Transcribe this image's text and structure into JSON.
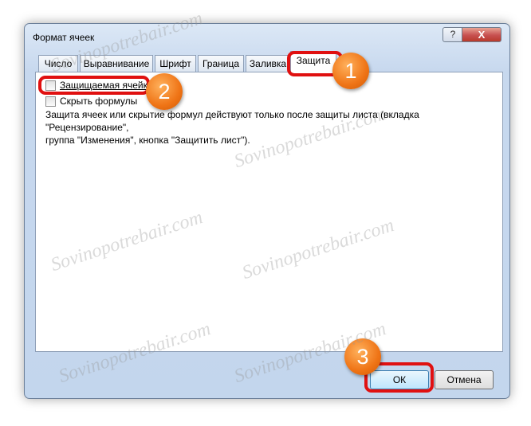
{
  "window": {
    "title": "Формат ячеек",
    "help_label": "?",
    "close_label": "X"
  },
  "tabs": [
    {
      "label": "Число"
    },
    {
      "label": "Выравнивание"
    },
    {
      "label": "Шрифт"
    },
    {
      "label": "Граница"
    },
    {
      "label": "Заливка"
    },
    {
      "label": "Защита",
      "active": true
    }
  ],
  "protection": {
    "locked_label": "Защищаемая ячейка",
    "locked_checked": false,
    "hidden_label": "Скрыть формулы",
    "hidden_checked": false,
    "description_line1": "Защита ячеек или скрытие формул действуют только после защиты листа (вкладка \"Рецензирование\",",
    "description_line2": "группа \"Изменения\", кнопка \"Защитить лист\")."
  },
  "buttons": {
    "ok": "ОК",
    "cancel": "Отмена"
  },
  "annotations": {
    "badge1": "1",
    "badge2": "2",
    "badge3": "3",
    "color": "#e01010",
    "badge_color": "#ef7416"
  },
  "watermark": "Sovinopotrebair.com"
}
